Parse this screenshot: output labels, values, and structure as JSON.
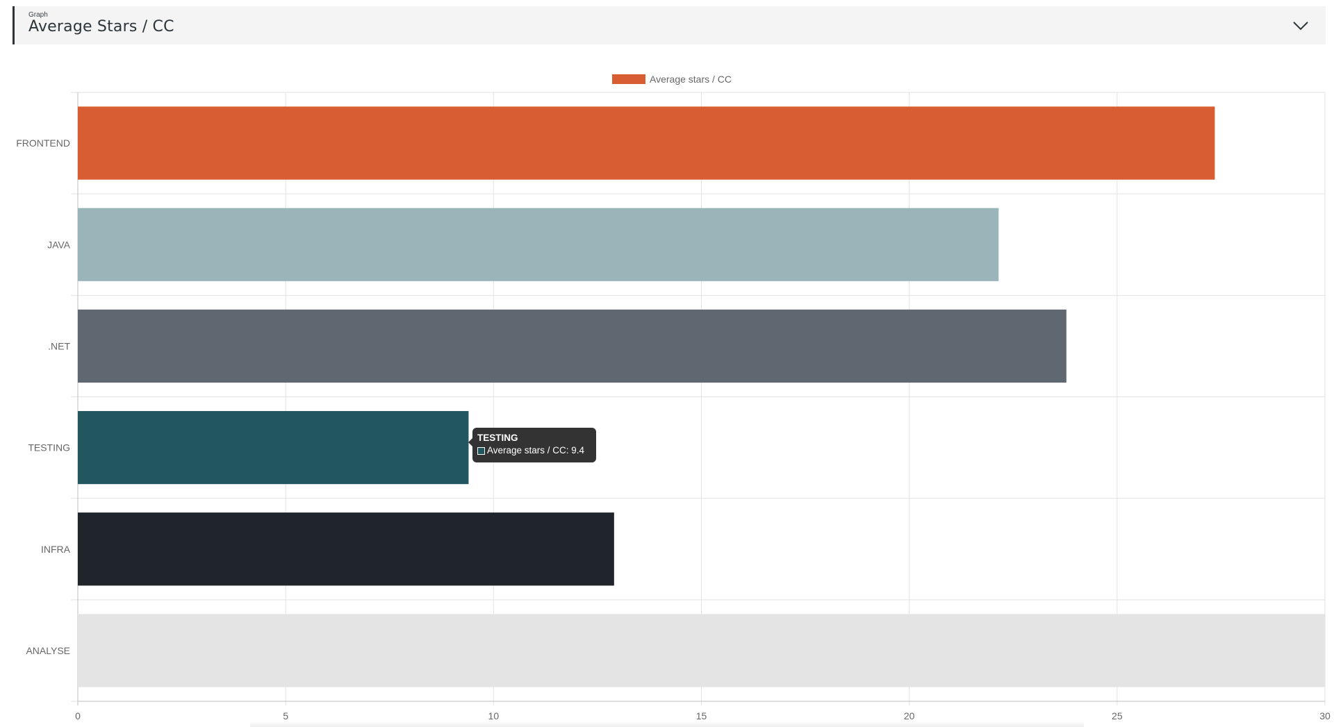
{
  "selector": {
    "small_label": "Graph",
    "value": "Average Stars / CC"
  },
  "tooltip": {
    "title": "TESTING",
    "label": "Average stars / CC: 9.4",
    "swatch_color": "#22575f"
  },
  "chart_data": {
    "type": "bar",
    "orientation": "horizontal",
    "categories": [
      "FRONTEND",
      "JAVA",
      ".NET",
      "TESTING",
      "INFRA",
      "ANALYSE"
    ],
    "series": [
      {
        "name": "Average stars / CC",
        "values": [
          27.35,
          22.15,
          23.78,
          9.4,
          12.9,
          30
        ],
        "colors": [
          "#d95d33",
          "#99b5ba",
          "#5f6870",
          "#22575f",
          "#20242b",
          "#e4e4e4"
        ]
      }
    ],
    "legend_color": "#d95d33",
    "xlim": [
      0,
      30
    ],
    "xticks": [
      0,
      5,
      10,
      15,
      20,
      25,
      30
    ],
    "grid": true,
    "legend": "top-center"
  }
}
